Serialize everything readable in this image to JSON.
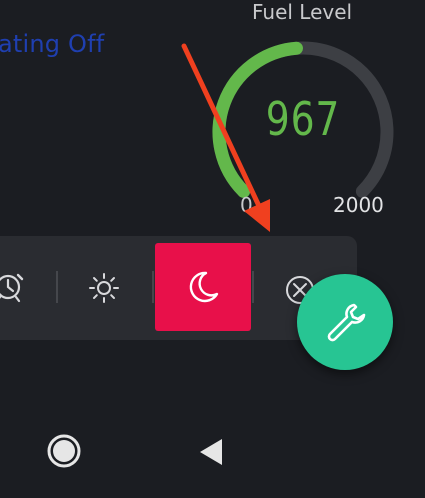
{
  "heating_status": "ating Off",
  "gauge": {
    "title": "Fuel Level",
    "value": "967",
    "fraction": 0.4835,
    "min_label": "0",
    "max_label": "2000"
  },
  "mode_bar": {
    "active_mode": "night"
  },
  "colors": {
    "background": "#1b1d22",
    "heating_text": "#1f3fb0",
    "gauge_fill": "#63b84b",
    "gauge_track": "#3d3f44",
    "active_mode": "#e8104a",
    "fab": "#27c593",
    "annotation_arrow": "#f0401f"
  },
  "icons": {
    "mode_alarm": "alarm-clock-icon",
    "mode_day": "sun-icon",
    "mode_night": "moon-icon",
    "mode_off": "circle-x-icon",
    "fab": "wrench-icon",
    "nav_home": "home-circle-icon",
    "nav_back": "back-triangle-icon"
  }
}
